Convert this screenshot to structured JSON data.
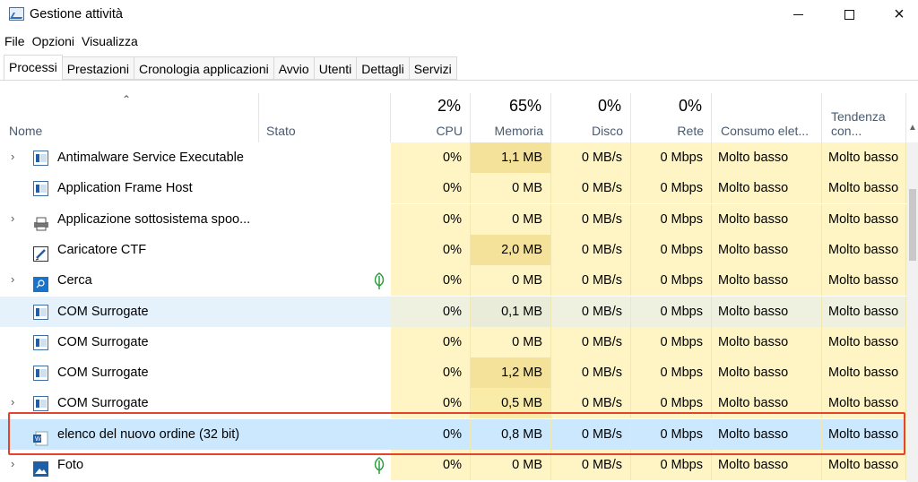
{
  "window": {
    "title": "Gestione attività"
  },
  "menu": [
    "File",
    "Opzioni",
    "Visualizza"
  ],
  "tabs": [
    "Processi",
    "Prestazioni",
    "Cronologia applicazioni",
    "Avvio",
    "Utenti",
    "Dettagli",
    "Servizi"
  ],
  "active_tab": "Processi",
  "columns": {
    "name": "Nome",
    "status": "Stato",
    "cpu": {
      "label": "CPU",
      "usage": "2%"
    },
    "memory": {
      "label": "Memoria",
      "usage": "65%"
    },
    "disk": {
      "label": "Disco",
      "usage": "0%"
    },
    "network": {
      "label": "Rete",
      "usage": "0%"
    },
    "power": "Consumo elet...",
    "power_trend": "Tendenza con..."
  },
  "processes": [
    {
      "name": "Antimalware Service Executable",
      "expand": "›",
      "icon": "app-window-icon",
      "cpu": "0%",
      "memory": "1,1 MB",
      "disk": "0 MB/s",
      "network": "0 Mbps",
      "power": "Molto basso",
      "trend": "Molto basso"
    },
    {
      "name": "Application Frame Host",
      "expand": "",
      "icon": "app-window-icon",
      "cpu": "0%",
      "memory": "0 MB",
      "disk": "0 MB/s",
      "network": "0 Mbps",
      "power": "Molto basso",
      "trend": "Molto basso"
    },
    {
      "name": "Applicazione sottosistema spoo...",
      "expand": "›",
      "icon": "printer-icon",
      "cpu": "0%",
      "memory": "0 MB",
      "disk": "0 MB/s",
      "network": "0 Mbps",
      "power": "Molto basso",
      "trend": "Molto basso"
    },
    {
      "name": "Caricatore CTF",
      "expand": "",
      "icon": "ctf-pen-icon",
      "cpu": "0%",
      "memory": "2,0 MB",
      "disk": "0 MB/s",
      "network": "0 Mbps",
      "power": "Molto basso",
      "trend": "Molto basso"
    },
    {
      "name": "Cerca",
      "expand": "›",
      "icon": "search-icon",
      "suspended": true,
      "cpu": "0%",
      "memory": "0 MB",
      "disk": "0 MB/s",
      "network": "0 Mbps",
      "power": "Molto basso",
      "trend": "Molto basso"
    },
    {
      "name": "COM Surrogate",
      "expand": "",
      "icon": "app-window-icon",
      "hover": true,
      "cpu": "0%",
      "memory": "0,1 MB",
      "disk": "0 MB/s",
      "network": "0 Mbps",
      "power": "Molto basso",
      "trend": "Molto basso"
    },
    {
      "name": "COM Surrogate",
      "expand": "",
      "icon": "app-window-icon",
      "cpu": "0%",
      "memory": "0 MB",
      "disk": "0 MB/s",
      "network": "0 Mbps",
      "power": "Molto basso",
      "trend": "Molto basso"
    },
    {
      "name": "COM Surrogate",
      "expand": "",
      "icon": "app-window-icon",
      "cpu": "0%",
      "memory": "1,2 MB",
      "disk": "0 MB/s",
      "network": "0 Mbps",
      "power": "Molto basso",
      "trend": "Molto basso"
    },
    {
      "name": "COM Surrogate",
      "expand": "›",
      "icon": "app-window-icon",
      "cpu": "0%",
      "memory": "0,5 MB",
      "disk": "0 MB/s",
      "network": "0 Mbps",
      "power": "Molto basso",
      "trend": "Molto basso"
    },
    {
      "name": "elenco del nuovo ordine (32 bit)",
      "expand": "",
      "icon": "document-app-icon",
      "selected": true,
      "cpu": "0%",
      "memory": "0,8 MB",
      "disk": "0 MB/s",
      "network": "0 Mbps",
      "power": "Molto basso",
      "trend": "Molto basso"
    },
    {
      "name": "Foto",
      "expand": "›",
      "icon": "photos-icon",
      "suspended": true,
      "cpu": "0%",
      "memory": "0 MB",
      "disk": "0 MB/s",
      "network": "0 Mbps",
      "power": "Molto basso",
      "trend": "Molto basso"
    }
  ],
  "colors": {
    "heat_light": "#fff4c4",
    "heat_memory": "#f9eca8",
    "heat_memory_strong": "#f4e29a",
    "hover_row": "#e5f1fb",
    "selected_row": "#cce8ff",
    "highlight_border": "#e4442b",
    "leaf_green": "#2e9e3e"
  }
}
